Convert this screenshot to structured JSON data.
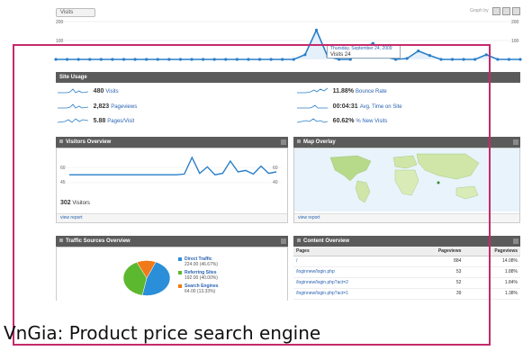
{
  "top_tab": "Visits",
  "graph_by": "Graph by",
  "top_axis": {
    "left_top": "200",
    "left_mid": "100",
    "right_top": "200",
    "right_mid": "100"
  },
  "tooltip": {
    "date": "Thursday, September 24, 2009",
    "value": "Visits 24"
  },
  "site_usage": {
    "title": "Site Usage",
    "metrics": [
      {
        "value": "480",
        "label": "Visits"
      },
      {
        "value": "2,823",
        "label": "Pageviews"
      },
      {
        "value": "5.88",
        "label": "Pages/Visit"
      },
      {
        "value": "11.88%",
        "label": "Bounce Rate"
      },
      {
        "value": "00:04:31",
        "label": "Avg. Time on Site"
      },
      {
        "value": "60.62%",
        "label": "% New Visits"
      }
    ]
  },
  "visitors_overview": {
    "title": "Visitors Overview",
    "axis_left_top": "60",
    "axis_left_mid": "45",
    "axis_right_top": "60",
    "axis_right_mid": "40",
    "count": "302",
    "count_label": "Visitors",
    "view_report": "view report"
  },
  "map_overlay": {
    "title": "Map Overlay",
    "view_report": "view report"
  },
  "traffic_sources": {
    "title": "Traffic Sources Overview",
    "items": [
      {
        "label": "Direct Traffic",
        "detail": "224.00 (46.67%)",
        "color": "#2a8fd8"
      },
      {
        "label": "Referring Sites",
        "detail": "192.00 (40.00%)",
        "color": "#5cb82e"
      },
      {
        "label": "Search Engines",
        "detail": "64.00 (13.33%)",
        "color": "#f07a1a"
      }
    ]
  },
  "content_overview": {
    "title": "Content Overview",
    "columns": [
      "Pages",
      "Pageviews",
      "Pageviews"
    ],
    "rows": [
      {
        "page": "/",
        "pageviews": "884",
        "pct": "14.08%"
      },
      {
        "page": "/loginnew/login.php",
        "pageviews": "53",
        "pct": "1.88%"
      },
      {
        "page": "/loginnew/login.php?act=2",
        "pageviews": "52",
        "pct": "1.84%"
      },
      {
        "page": "/loginnew/login.php?act=1",
        "pageviews": "39",
        "pct": "1.38%"
      }
    ]
  },
  "caption": "VnGia: Product price search engine",
  "colors": {
    "frame": "#c52a6b",
    "line": "#2a7fc8",
    "header_bar": "#5b5b5b"
  },
  "chart_data": [
    {
      "type": "line",
      "name": "top-visits",
      "ylim": [
        0,
        200
      ],
      "values": [
        24,
        24,
        24,
        24,
        24,
        24,
        24,
        24,
        24,
        24,
        24,
        24,
        24,
        24,
        24,
        24,
        24,
        24,
        24,
        24,
        24,
        25,
        60,
        125,
        55,
        30,
        24,
        75,
        90,
        55,
        20,
        50,
        70,
        58,
        28,
        28,
        30,
        42,
        60,
        40,
        45,
        28
      ]
    },
    {
      "type": "line",
      "name": "visitors-overview",
      "ylim": [
        0,
        60
      ],
      "values": [
        36,
        36,
        36,
        36,
        36,
        36,
        36,
        36,
        36,
        36,
        36,
        36,
        36,
        36,
        36,
        37,
        60,
        38,
        47,
        36,
        38,
        55,
        40,
        42,
        37,
        48,
        38,
        40
      ]
    }
  ]
}
